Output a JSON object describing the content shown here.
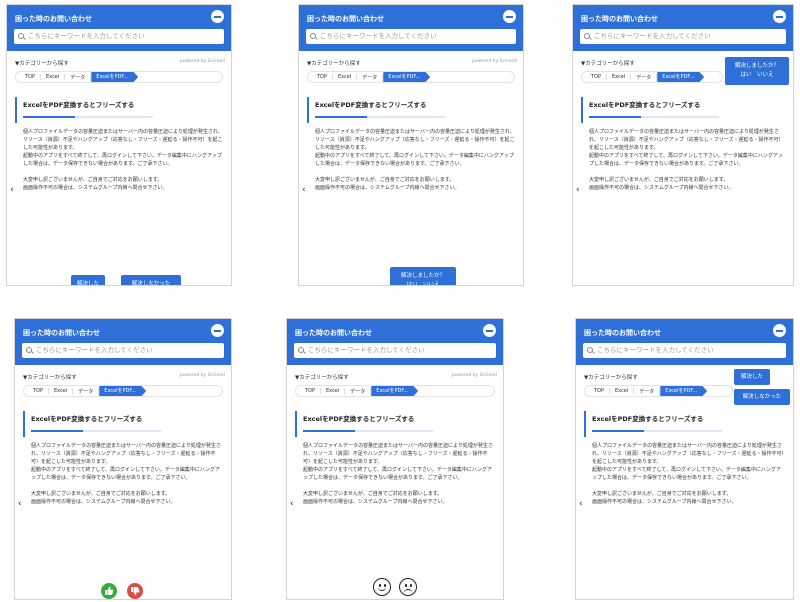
{
  "header": {
    "title": "困った時のお問い合わせ",
    "search_placeholder": "こちらにキーワードを入力してください"
  },
  "category_label": "▼カテゴリーから探す",
  "powered_by": "powered by Sciseed",
  "breadcrumb": [
    "TOP",
    "Excel",
    "データ",
    "ExcelをPDF..."
  ],
  "article": {
    "title": "ExcelをPDF変換するとフリーズする",
    "para1": "個人プロファイルデータの容量圧迫またはサーバー内の容量圧迫により処理が発生され、リソース（資源）不足やハングアップ（応答なし・フリーズ・遅延る・操作不可）を起こした可能性があります。",
    "para2": "起動中のアプリをすべて終了して、再ログインして下さい。データ編集中にハングアップした場合は、データ保存できない場合があります。ご了承下さい。",
    "para3": "大変申し訳ございませんが、ご自身でご対応をお願いします。",
    "para4": "画面操作不可の場合は、システムグループ内線へ問合せ下さい。"
  },
  "feedback": {
    "solved": "解決した",
    "unsolved": "解決しなかった",
    "question": "解決しましたか？",
    "yes_no": "はい　いいえ"
  },
  "colors": {
    "header_blue": "#2e6fd8",
    "thumb_up_green": "#38a93c",
    "thumb_down_red": "#e04848"
  },
  "icons": [
    "search-icon",
    "minus-icon",
    "chevron-left-icon",
    "thumbs-up-icon",
    "thumbs-down-icon",
    "smiley-face-icon",
    "frowny-face-icon"
  ]
}
